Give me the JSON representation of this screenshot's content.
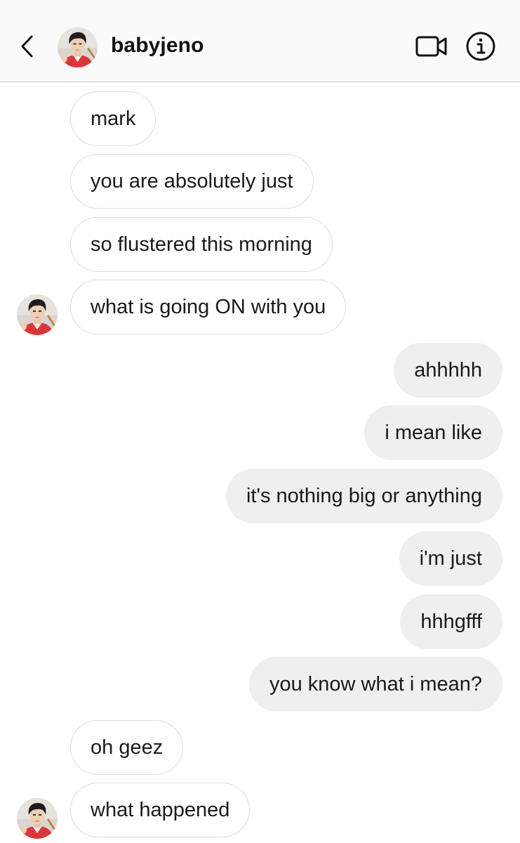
{
  "header": {
    "back_icon": "chevron-left-icon",
    "username": "babyjeno",
    "video_icon": "video-camera-icon",
    "info_icon": "info-icon"
  },
  "colors": {
    "header_bg": "#fafafa",
    "incoming_bubble_border": "#dcdcdc",
    "outgoing_bubble_bg": "#efefef",
    "text": "#1a1a1a"
  },
  "messages": [
    {
      "sender": "them",
      "text": "mark"
    },
    {
      "sender": "them",
      "text": "you are absolutely just"
    },
    {
      "sender": "them",
      "text": "so flustered this morning"
    },
    {
      "sender": "them",
      "text": "what is going ON with you"
    },
    {
      "sender": "me",
      "text": "ahhhhh"
    },
    {
      "sender": "me",
      "text": "i mean like"
    },
    {
      "sender": "me",
      "text": "it's nothing big or anything"
    },
    {
      "sender": "me",
      "text": "i'm just"
    },
    {
      "sender": "me",
      "text": "hhhgfff"
    },
    {
      "sender": "me",
      "text": "you know what i mean?"
    },
    {
      "sender": "them",
      "text": "oh geez"
    },
    {
      "sender": "them",
      "text": "what happened"
    }
  ]
}
